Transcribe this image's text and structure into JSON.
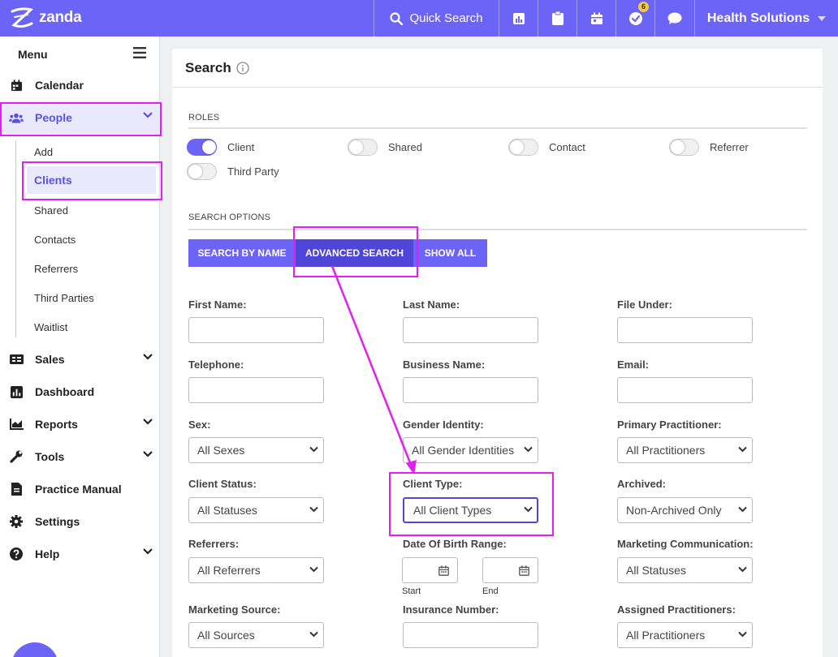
{
  "topbar": {
    "brand": "zanda",
    "quick_search": "Quick Search",
    "tasks_badge": "6",
    "org_name": "Health Solutions",
    "color": "#6c63f7"
  },
  "sidebar": {
    "menu_label": "Menu",
    "items": [
      {
        "label": "Calendar",
        "icon": "calendar-icon"
      },
      {
        "label": "People",
        "icon": "users-icon"
      },
      {
        "label": "Sales",
        "icon": "receipt-icon"
      },
      {
        "label": "Dashboard",
        "icon": "dashboard-icon"
      },
      {
        "label": "Reports",
        "icon": "chart-icon"
      },
      {
        "label": "Tools",
        "icon": "wrench-icon"
      },
      {
        "label": "Practice Manual",
        "icon": "document-icon"
      },
      {
        "label": "Settings",
        "icon": "gear-icon"
      },
      {
        "label": "Help",
        "icon": "question-icon"
      }
    ],
    "people_sub": [
      "Add",
      "Clients",
      "Shared",
      "Contacts",
      "Referrers",
      "Third Parties",
      "Waitlist"
    ]
  },
  "search": {
    "title": "Search",
    "roles_label": "ROLES",
    "roles": [
      {
        "label": "Client",
        "on": true
      },
      {
        "label": "Shared",
        "on": false
      },
      {
        "label": "Contact",
        "on": false
      },
      {
        "label": "Referrer",
        "on": false
      },
      {
        "label": "Third Party",
        "on": false
      }
    ],
    "options_label": "SEARCH OPTIONS",
    "buttons": [
      "SEARCH BY NAME",
      "ADVANCED SEARCH",
      "SHOW ALL"
    ],
    "fields": {
      "first_name": "First Name:",
      "last_name": "Last Name:",
      "file_under": "File Under:",
      "telephone": "Telephone:",
      "business_name": "Business Name:",
      "email": "Email:",
      "sex": "Sex:",
      "gender_identity": "Gender Identity:",
      "primary_practitioner": "Primary Practitioner:",
      "client_status": "Client Status:",
      "client_type": "Client Type:",
      "archived": "Archived:",
      "referrers": "Referrers:",
      "dob_range": "Date Of Birth Range:",
      "marketing_communication": "Marketing Communication:",
      "marketing_source": "Marketing Source:",
      "insurance_number": "Insurance Number:",
      "assigned_practitioners": "Assigned Practitioners:"
    },
    "selects": {
      "sex": "All Sexes",
      "gender_identity": "All Gender Identities",
      "primary_practitioner": "All Practitioners",
      "client_status": "All Statuses",
      "client_type": "All Client Types",
      "archived": "Non-Archived Only",
      "referrers": "All Referrers",
      "marketing_communication": "All Statuses",
      "marketing_source": "All Sources",
      "assigned_practitioners": "All Practitioners"
    },
    "dob_start": "Start",
    "dob_end": "End"
  }
}
